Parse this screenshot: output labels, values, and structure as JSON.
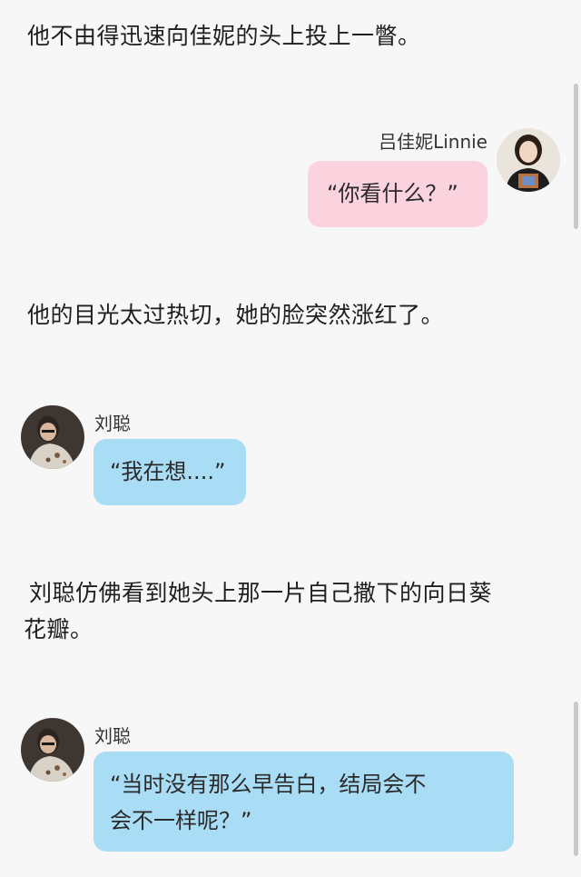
{
  "messages": {
    "narration_1": "他不由得迅速向佳妮的头上投上一瞥。",
    "chat_1": {
      "sender": "吕佳妮Linnie",
      "text": "“你看什么？”"
    },
    "narration_2": "他的目光太过热切，她的脸突然涨红了。",
    "chat_2": {
      "sender": "刘聪",
      "text": "“我在想....”"
    },
    "narration_3_line1": "刘聪仿佛看到她头上那一片自己撒下的向日葵",
    "narration_3_line2": "花瓣。",
    "chat_3": {
      "sender": "刘聪",
      "text_line1": "“当时没有那么早告白，结局会不",
      "text_line2": "会不一样呢？”"
    }
  },
  "colors": {
    "pink_bubble": "#fbd3de",
    "blue_bubble": "#a9dcf5",
    "background": "#f7f7f7"
  },
  "icons": {
    "avatar_female": "avatar-linnie",
    "avatar_male": "avatar-liucong"
  }
}
